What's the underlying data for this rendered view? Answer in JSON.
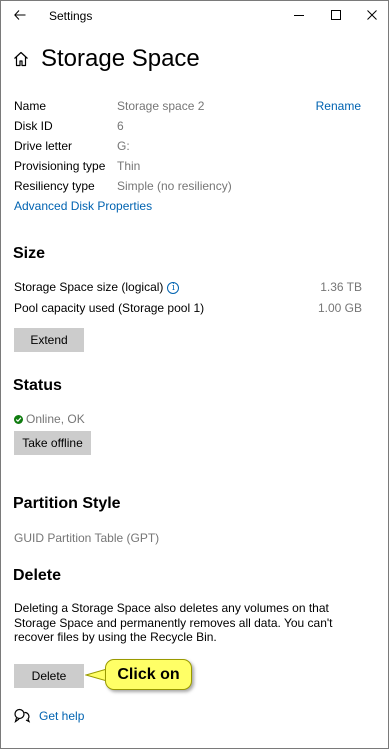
{
  "window": {
    "title": "Settings"
  },
  "titlebar": {
    "back_icon": "back-arrow-icon",
    "minimize_icon": "minimize-icon",
    "maximize_icon": "maximize-icon",
    "close_icon": "close-icon"
  },
  "header": {
    "icon": "home-icon",
    "title": "Storage Space"
  },
  "properties": [
    {
      "label": "Name",
      "value": "Storage space 2"
    },
    {
      "label": "Disk ID",
      "value": "6"
    },
    {
      "label": "Drive letter",
      "value": "G:"
    },
    {
      "label": "Provisioning type",
      "value": "Thin"
    },
    {
      "label": "Resiliency type",
      "value": "Simple (no resiliency)"
    }
  ],
  "rename_label": "Rename",
  "advanced_link": "Advanced Disk Properties",
  "size": {
    "title": "Size",
    "rows": [
      {
        "label": "Storage Space size (logical)",
        "value": "1.36 TB",
        "info_icon": "info-icon"
      },
      {
        "label": "Pool capacity used (Storage pool 1)",
        "value": "1.00 GB"
      }
    ],
    "extend_label": "Extend"
  },
  "status": {
    "title": "Status",
    "value": "Online, OK",
    "status_icon": "ok-check-icon",
    "status_color": "#107c10",
    "take_offline_label": "Take offline"
  },
  "partition": {
    "title": "Partition Style",
    "value": "GUID Partition Table (GPT)"
  },
  "delete": {
    "title": "Delete",
    "description": "Deleting a Storage Space also deletes any volumes on that Storage Space and permanently removes all data. You can't recover files by using the Recycle Bin.",
    "button_label": "Delete"
  },
  "callout": {
    "text": "Click on",
    "color": "#ffff66"
  },
  "help": {
    "icon": "chat-help-icon",
    "label": "Get help"
  },
  "colors": {
    "link": "#0063b1",
    "secondary_text": "#767676",
    "button_bg": "#cccccc"
  }
}
